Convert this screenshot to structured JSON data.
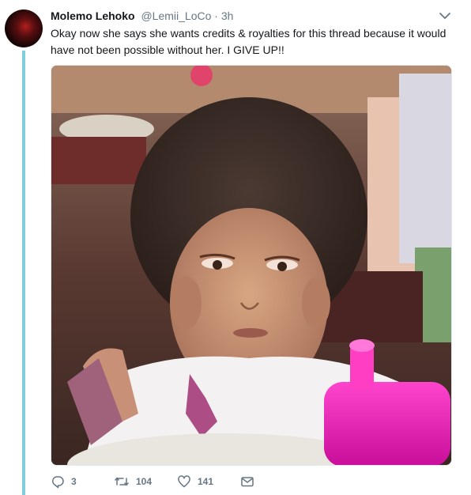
{
  "tweet": {
    "author_name": "Molemo Lehoko",
    "author_handle": "@Lemii_LoCo",
    "separator": "·",
    "time": "3h",
    "text": "Okay now she says she wants credits & royalties for this thread because it would have not been possible without her. I GIVE UP!!",
    "media_icon": "photo"
  },
  "actions": {
    "reply_count": "3",
    "retweet_count": "104",
    "like_count": "141"
  },
  "colors": {
    "thread_line": "#7fd0dc",
    "secondary_text": "#657786",
    "primary_text": "#14171a"
  }
}
